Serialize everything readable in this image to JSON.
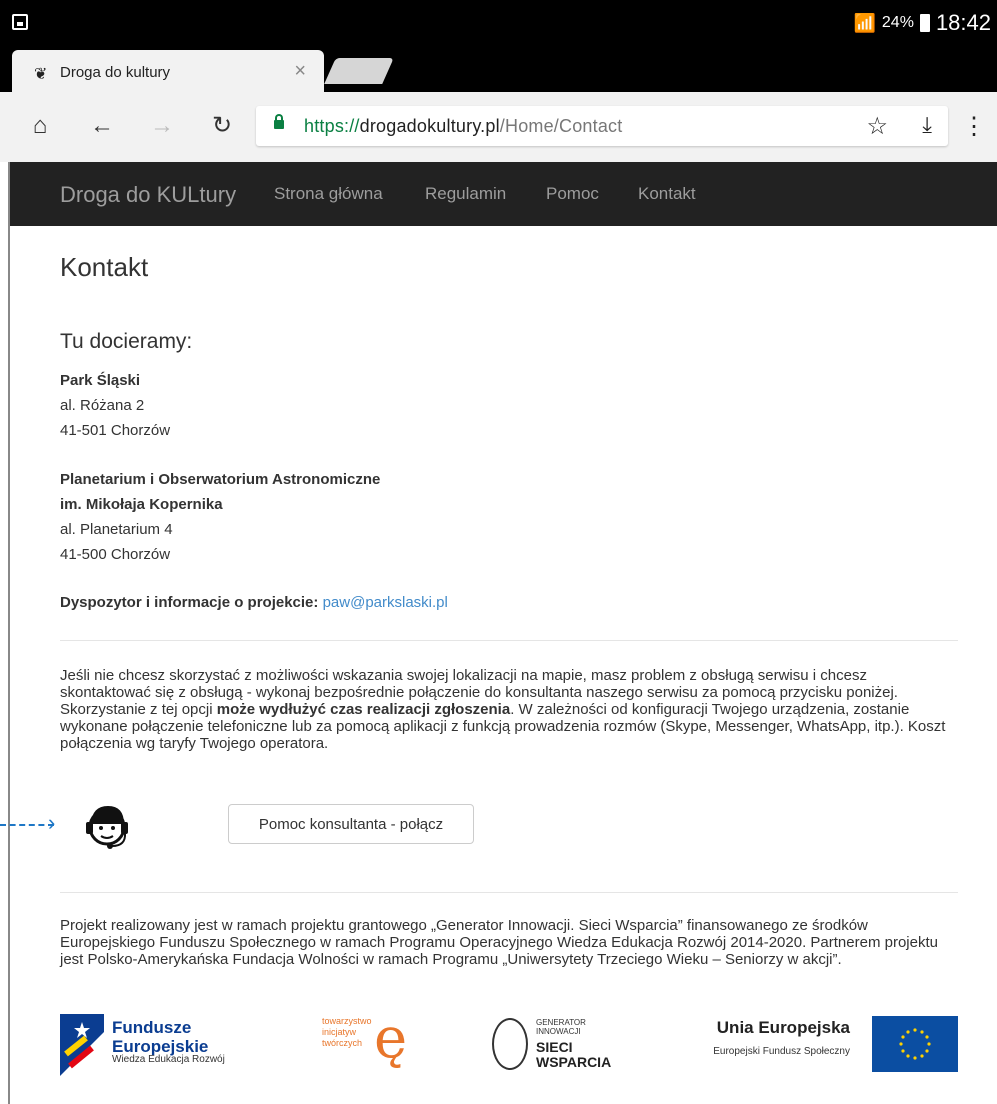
{
  "status_bar": {
    "battery_pct": "24%",
    "time": "18:42"
  },
  "tab": {
    "title": "Droga do kultury",
    "close": "×"
  },
  "toolbar": {
    "url_scheme": "https://",
    "url_host": "drogadokultury.pl",
    "url_path": "/Home/Contact"
  },
  "navbar": {
    "brand": "Droga do KULtury",
    "links": [
      "Strona główna",
      "Regulamin",
      "Pomoc",
      "Kontakt"
    ]
  },
  "content": {
    "title": "Kontakt",
    "subtitle": "Tu docieramy:",
    "addresses": [
      {
        "name": "Park Śląski",
        "line1": "al. Różana 2",
        "line2": "41-501 Chorzów"
      },
      {
        "name": "Planetarium i Obserwatorium Astronomiczne",
        "name2": "im. Mikołaja Kopernika",
        "line1": "al. Planetarium 4",
        "line2": "41-500 Chorzów"
      }
    ],
    "contact_label": "Dyspozytor i informacje o projekcie:",
    "contact_email": "paw@parkslaski.pl",
    "info_part1": "Jeśli nie chcesz skorzystać z możliwości wskazania swojej lokalizacji na mapie, masz problem z obsługą serwisu i chcesz skontaktować się z obsługą - wykonaj bezpośrednie połączenie do konsultanta naszego serwisu za pomocą przycisku poniżej. Skorzystanie z tej opcji ",
    "info_bold": "może wydłużyć czas realizacji zgłoszenia",
    "info_part2": ". W zależności od konfiguracji Twojego urządzenia, zostanie wykonane połączenie telefoniczne lub za pomocą aplikacji z funkcją prowadzenia rozmów (Skype, Messenger, WhatsApp, itp.). Koszt połączenia wg taryfy Twojego operatora.",
    "consult_button": "Pomoc konsultanta - połącz",
    "footer_text": "Projekt realizowany jest w ramach projektu grantowego „Generator Innowacji. Sieci Wsparcia” finansowanego ze środków Europejskiego Funduszu Społecznego w ramach Programu Operacyjnego Wiedza Edukacja Rozwój 2014-2020. Partnerem projektu jest Polsko-Amerykańska Fundacja Wolności w ramach Programu „Uniwersytety Trzeciego Wieku – Seniorzy w akcji”."
  },
  "logos": {
    "fe_line1": "Fundusze",
    "fe_line2": "Europejskie",
    "fe_sub": "Wiedza Edukacja Rozwój",
    "tow": "towarzystwo inicjatyw twórczych",
    "tow_letter": "ę",
    "gi_small": "GENERATOR INNOWACJI",
    "gi_big1": "SIECI",
    "gi_big2": "WSPARCIA",
    "ue_title": "Unia Europejska",
    "ue_sub": "Europejski Fundusz Społeczny"
  },
  "colors": {
    "navbar_bg": "#222222",
    "link": "#428bca",
    "secure_green": "#0b8043",
    "annotation_arrow": "#1e77c6"
  }
}
